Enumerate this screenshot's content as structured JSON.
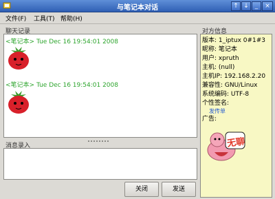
{
  "window": {
    "title": "与笔记本对话",
    "buttons": [
      "↑",
      "↓",
      "_",
      "□",
      "×"
    ]
  },
  "menu": [
    "文件(F)",
    "工具(T)",
    "帮助(H)"
  ],
  "chat": {
    "label": "聊天记录",
    "messages": [
      {
        "sender": "<笔记本>",
        "time": "Tue Dec 16 19:54:01 2008"
      },
      {
        "sender": "<笔记本>",
        "time": "Tue Dec 16 19:54:01 2008"
      }
    ]
  },
  "input": {
    "label": "消息录入",
    "value": ""
  },
  "buttons": {
    "close": "关闭",
    "send": "发送"
  },
  "info": {
    "label": "对方信息",
    "lines": [
      "版本: 1_iptux 0#1#3",
      "昵称: 笔记本",
      "用户: xpruth",
      "主机: (null)",
      "主机IP: 192.168.2.20",
      "兼容性: GNU/Linux",
      "系统编码: UTF-8",
      "个性签名:"
    ],
    "signature": "发传单",
    "ad_label": "广告:",
    "ad_text": "无聊"
  },
  "colors": {
    "titlebar": "#2f5fb4",
    "nick": "#2ea52e",
    "window_bg": "#dcdad5",
    "info_bg": "#f8f8c4"
  }
}
